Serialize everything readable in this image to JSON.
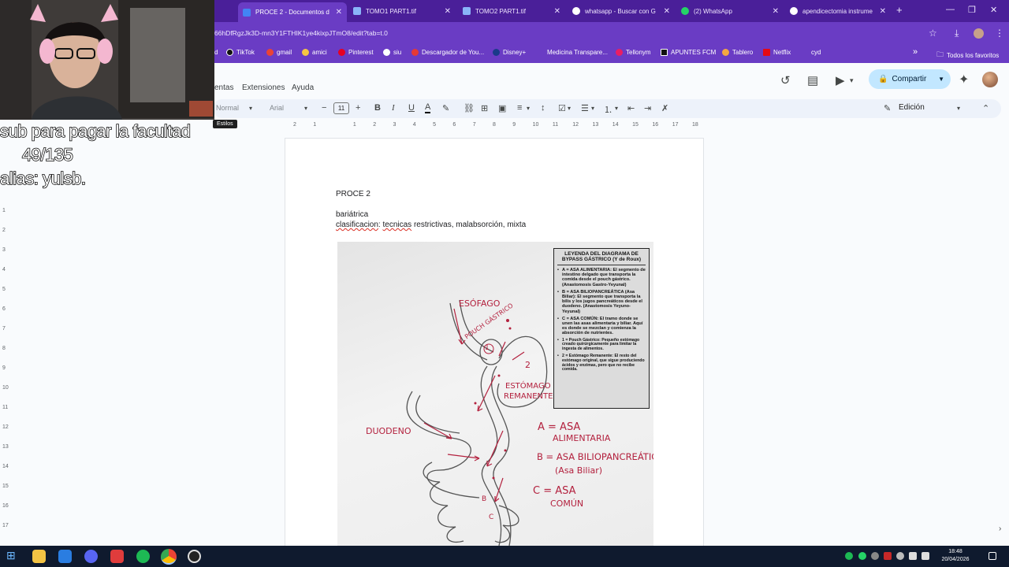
{
  "browser": {
    "tabs": [
      {
        "label": "PROCE 2 - Documentos d",
        "active": true,
        "fav_color": "#4285f4"
      },
      {
        "label": "TOMO1 PART1.tif",
        "active": false,
        "fav_color": "#8ab4f8"
      },
      {
        "label": "TOMO2 PART1.tif",
        "active": false,
        "fav_color": "#8ab4f8"
      },
      {
        "label": "whatsapp - Buscar con G",
        "active": false,
        "fav_color": "#ffffff"
      },
      {
        "label": "(2) WhatsApp",
        "active": false,
        "fav_color": "#25d366"
      },
      {
        "label": "apendicectomia instrume",
        "active": false,
        "fav_color": "#ffffff"
      }
    ],
    "new_tab": "+",
    "url": "66hDfRgzJk3D-mn3Y1FTHIK1ye4kixpJTmO8/edit?tab=t.0",
    "bookmarks": [
      {
        "label": "d",
        "color": "#ffffff"
      },
      {
        "label": "TikTok",
        "color": "#111111"
      },
      {
        "label": "gmail",
        "color": "#ea4335"
      },
      {
        "label": "amici",
        "color": "#f5c542"
      },
      {
        "label": "Pinterest",
        "color": "#e60023"
      },
      {
        "label": "siu",
        "color": "#ffffff"
      },
      {
        "label": "Descargador de You...",
        "color": "#e53935"
      },
      {
        "label": "Disney+",
        "color": "#1a3a8a"
      },
      {
        "label": "Medicina Transpare...",
        "color": "#6a3cc4"
      },
      {
        "label": "Tellonym",
        "color": "#e91e63"
      },
      {
        "label": "APUNTES FCM",
        "color": "#111111"
      },
      {
        "label": "Tablero",
        "color": "#f4a742"
      },
      {
        "label": "Netflix",
        "color": "#e50914"
      },
      {
        "label": "cyd",
        "color": "#6a3cc4"
      }
    ],
    "bookmarks_overflow": "»",
    "all_favorites": "Todos los favoritos"
  },
  "docs": {
    "menus": [
      "entas",
      "Extensiones",
      "Ayuda"
    ],
    "share_label": "Compartir",
    "toolbar": {
      "style": "Normal",
      "font": "Arial",
      "font_size": "11",
      "mode": "Edición"
    },
    "tooltip": "Estilos",
    "ruler_numbers": [
      "2",
      "1",
      "",
      "1",
      "2",
      "3",
      "4",
      "5",
      "6",
      "7",
      "8",
      "9",
      "10",
      "11",
      "12",
      "13",
      "14",
      "15",
      "16",
      "17",
      "18"
    ],
    "vruler_numbers": [
      "1",
      "2",
      "3",
      "4",
      "5",
      "6",
      "7",
      "8",
      "9",
      "10",
      "11",
      "12",
      "13",
      "14",
      "15",
      "16",
      "17"
    ]
  },
  "document": {
    "title": "PROCE 2",
    "line1": "bariátrica",
    "line2_word1": "clasificacion",
    "line2_sep": ": ",
    "line2_word2": "tecnicas",
    "line2_rest": " restrictivas, malabsorción, mixta"
  },
  "diagram": {
    "legend_title": "LEYENDA DEL DIAGRAMA DE BYPASS GÁSTRICO (Y de Roux)",
    "legend_items": [
      "A = ASA ALIMENTARIA: El segmento de intestino delgado que transporta la comida desde el pouch gástrico. (Anastomosis Gastro-Yeyunal)",
      "B = ASA BILIOPANCREÁTICA (Asa Biliar): El segmento que transporta la bilis y los jugos pancreáticos desde el duodeno. (Anastomosis Yeyuno-Yeyunal)",
      "C = ASA COMÚN: El tramo donde se unen las asas alimentaria y biliar. Aquí es donde se mezclan y comienza la absorción de nutrientes.",
      "1 = Pouch Gástrico: Pequeño estómago creado quirúrgicamente para limitar la ingesta de alimentos.",
      "2 = Estómago Remanente: El resto del estómago original, que sigue produciendo ácidos y enzimas, pero que no recibe comida."
    ],
    "labels": {
      "esofago": "ESÓFAGO",
      "pouch": "POUCH GÁSTRICO",
      "one": "1",
      "two": "2",
      "estomago": "ESTÓMAGO",
      "remanente": "REMANENTE",
      "duodeno": "DUODENO",
      "a1": "A = ASA",
      "a2": "ALIMENTARIA",
      "b1": "B = ASA BILIOPANCREÁTICA",
      "b2": "(Asa Biliar)",
      "c1": "C = ASA",
      "c2": "COMÚN",
      "b_mark": "B",
      "c_mark": "C"
    }
  },
  "overlay": {
    "line1": "sub para pagar la facultad",
    "line2": "49/135",
    "line3": "alias: yulsb."
  },
  "taskbar": {
    "time": "18:48",
    "date": "20/04/2026"
  }
}
